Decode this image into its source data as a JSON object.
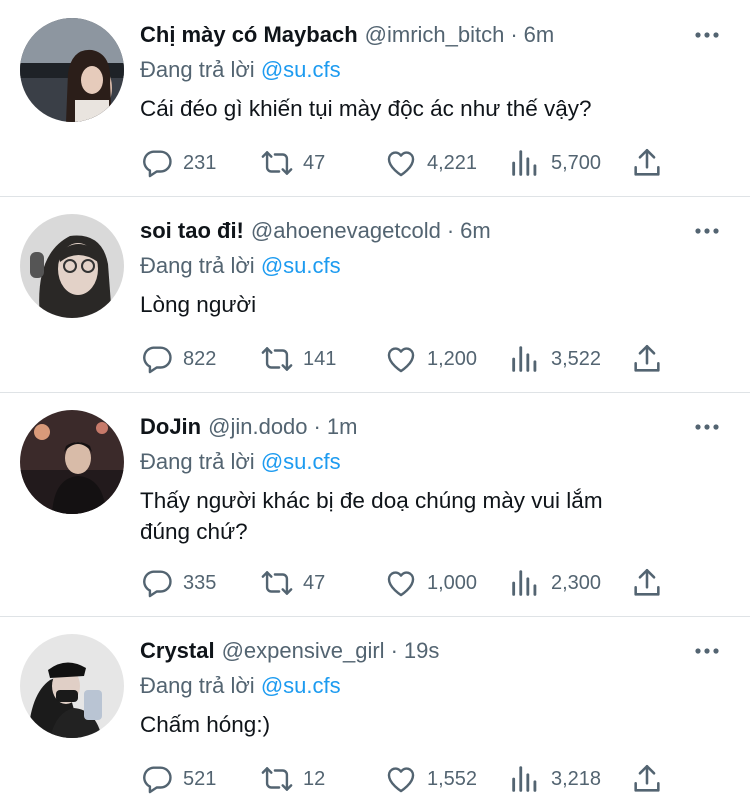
{
  "reply_prefix": "Đang trả lời",
  "tweets": [
    {
      "name": "Chị mày có Maybach",
      "handle": "@imrich_bitch",
      "time": "6m",
      "reply_to": "@su.cfs",
      "text": "Cái đéo gì khiến tụi mày độc ác như thế vậy?",
      "replies": "231",
      "retweets": "47",
      "likes": "4,221",
      "views": "5,700"
    },
    {
      "name": "soi tao đi!",
      "handle": "@ahoenevagetcold",
      "time": "6m",
      "reply_to": "@su.cfs",
      "text": "Lòng người",
      "replies": "822",
      "retweets": "141",
      "likes": "1,200",
      "views": "3,522"
    },
    {
      "name": "DoJin",
      "handle": "@jin.dodo",
      "time": "1m",
      "reply_to": "@su.cfs",
      "text": "Thấy người khác bị đe doạ chúng mày vui lắm đúng chứ?",
      "replies": "335",
      "retweets": "47",
      "likes": "1,000",
      "views": "2,300"
    },
    {
      "name": "Crystal",
      "handle": "@expensive_girl",
      "time": "19s",
      "reply_to": "@su.cfs",
      "text": "Chấm hóng:)",
      "replies": "521",
      "retweets": "12",
      "likes": "1,552",
      "views": "3,218"
    }
  ],
  "colors": {
    "link": "#1d9bf0",
    "secondary_text": "#536471",
    "primary_text": "#0f1419",
    "divider": "#dfe3e6"
  },
  "icons": [
    "reply-icon",
    "retweet-icon",
    "like-icon",
    "views-icon",
    "share-icon",
    "more-icon"
  ]
}
